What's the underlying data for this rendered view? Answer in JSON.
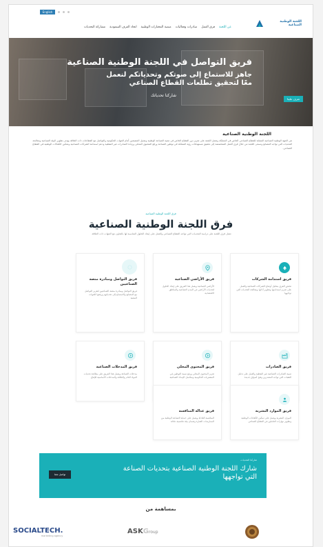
{
  "header": {
    "lang_label": "English",
    "logo_text": "اللجنة الوطنية الصناعية",
    "nav": [
      "عن اللجنة",
      "فرق العمل",
      "مبادرات وفعاليات",
      "منصة المختارات الوطنية",
      "اتحاد الغرف السعودية",
      "مشاركة التحديات"
    ]
  },
  "hero": {
    "title": "فريق التواصل في اللجنة الوطنية الصناعية",
    "subtitle": "جاهز للاستماع إلى صوتكم وتحدياتكم لنعمل معًا لتحقيق تطلعات القطاع الصناعي",
    "share": "شاركنا تحدياتك",
    "button": "تعرف علينا"
  },
  "about": {
    "title": "اللجنة الوطنية الصناعية",
    "text": "هي الجهة الوطنية الصناعية الممثلة للقطاع الصناعي الخاص في المملكة وتعمل اللجنة على تعزيز دور القطاع الخاص في تنمية الصناعة الوطنية وتمثيل المصنعين أمام الجهات الحكومية والتواصل مع القطاعات ذات العلاقة بهدف تطوير البيئة الصناعية ومعالجة التحديات التي تواجه المصانع وتسعى اللجنة من خلال فرق العمل المتخصصة إلى تحقيق مستهدفات رؤية المملكة في توطين الصناعة ورفع المحتوى المحلي وزيادة الصادرات غير النفطية ودعم استدامة الشركات الصناعية وتمكين الكفاءات الوطنية في القطاع الصناعي."
  },
  "teams": {
    "kicker": "فرق اللجنة الوطنية الصناعية",
    "title": "فرق اللجنة الوطنية الصناعية",
    "desc": "تعمل فرق اللجنة على دراسة التحديات التي تواجه القطاع الصناعي والعمل على إيجاد الحلول المناسبة لها بالتعاون مع الجهات ذات العلاقة",
    "cards": [
      {
        "title": "فريق استدامة الشركات",
        "desc": "تختص الفرق بتحليل أوضاع الشركات الصناعية والعمل على تعزيز استدامتها وتطوير أدائها ومعالجة التحديات التي تواجهها"
      },
      {
        "title": "فريق الأراضي الصناعية",
        "desc": "الأراضي الصناعية ويعمل هذا الفريق على إيجاد الحلول لتحديات الأراضي في المدن الصناعية والمناطق الاقتصادية"
      },
      {
        "title": "فريق التواصل ومبادرة منصة الصناعيين",
        "desc": "فريق التواصل ومبادرة منصة الصناعيين لتعزيز التواصل مع المصانع والاستماع إلى تحدياتهم ورفعها للجهات المعنية"
      },
      {
        "title": "فريق الصادرات",
        "desc": "تنمية الصادرات الصناعية غير النفطية والعمل على تذليل العقبات التي تواجه المصدرين وفتح أسواق جديدة"
      },
      {
        "title": "فريق المحتوى المحلي",
        "desc": "تعزيز المحتوى المحلي ورفع نسبة التوطين في المشتريات الحكومية وسلاسل الإمداد الصناعية"
      },
      {
        "title": "فريق المدخلات الصناعية",
        "desc": "مدخلات الصناعة ويعمل هذا الفريق على معالجة تحديات المواد الخام والطاقة والمدخلات الأساسية للإنتاج"
      },
      {
        "title": "فريق الموارد البشرية",
        "desc": "الموارد البشرية ويعمل على تمكين الكفاءات الوطنية وتطوير مهارات العاملين في القطاع الصناعي"
      },
      {
        "title": "فريق عدالة المنافسة",
        "desc": "المنافسة العادلة ويعمل على حماية الصناعة الوطنية من الممارسات الضارة وضمان بيئة تنافسية عادلة"
      }
    ]
  },
  "cta": {
    "kicker": "شاركنا التحديات",
    "title": "شارك اللجنة الوطنية الصناعية بتحديات الصناعة التي تواجهها",
    "button": "تواصل معنا"
  },
  "partners": {
    "title": "بمساهمة من",
    "social_name": "SOCIALTECH.",
    "social_sub": "marketing agency",
    "ask_name": "ASK",
    "ask_suffix": "roup"
  },
  "colors": {
    "accent": "#1ab0b8",
    "brand": "#1f6fa8",
    "dark": "#1e2b33"
  }
}
